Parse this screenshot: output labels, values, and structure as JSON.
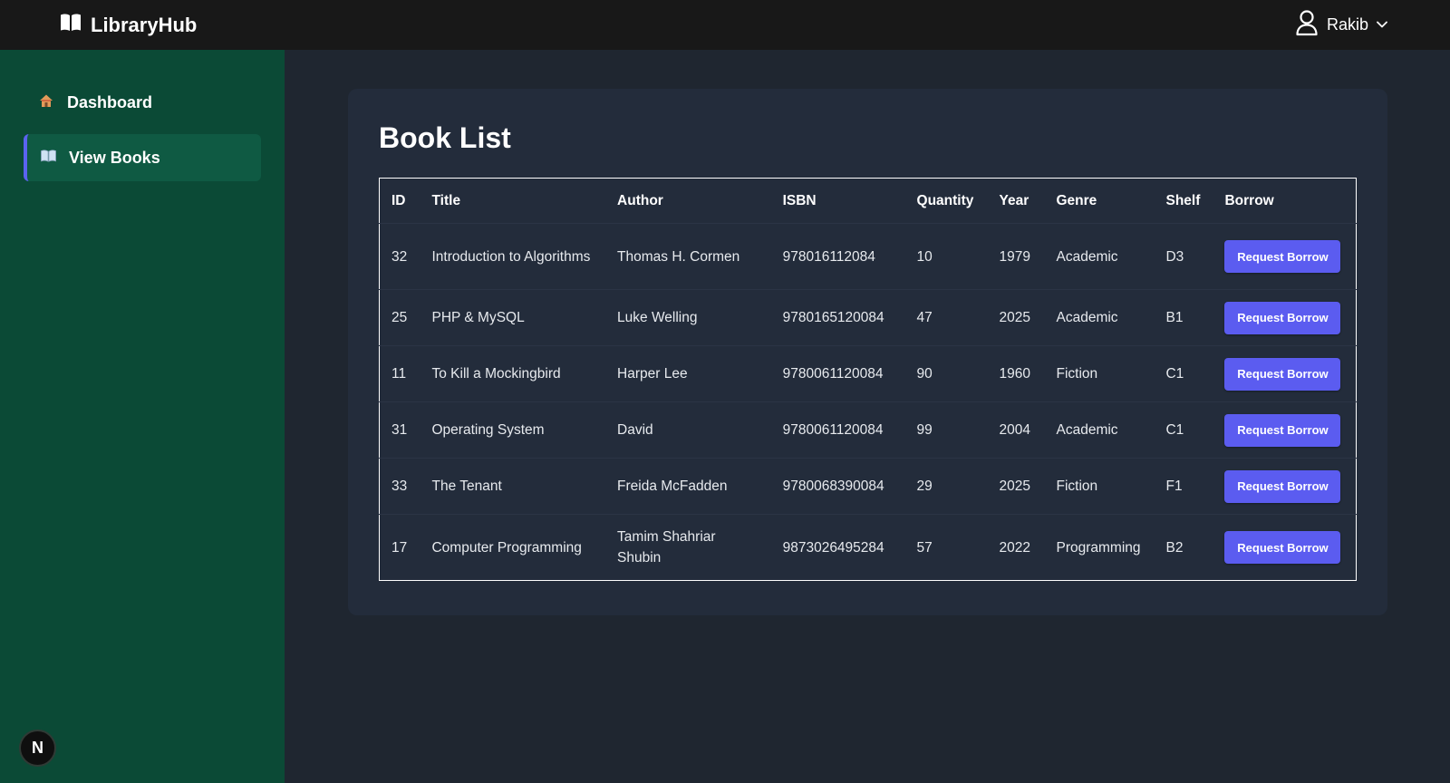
{
  "app": {
    "brand": "LibraryHub",
    "user_name": "Rakib"
  },
  "sidebar": {
    "items": [
      {
        "label": "Dashboard",
        "icon": "house-icon",
        "active": false
      },
      {
        "label": "View Books",
        "icon": "book-icon",
        "active": true
      }
    ],
    "badge": "N"
  },
  "main": {
    "title": "Book List",
    "columns": [
      "ID",
      "Title",
      "Author",
      "ISBN",
      "Quantity",
      "Year",
      "Genre",
      "Shelf",
      "Borrow"
    ],
    "borrow_button_label": "Request Borrow",
    "rows": [
      {
        "id": "32",
        "title": "Introduction to Algorithms",
        "author": "Thomas H. Cormen",
        "isbn": "978016112084",
        "quantity": "10",
        "year": "1979",
        "genre": "Academic",
        "shelf": "D3"
      },
      {
        "id": "25",
        "title": "PHP & MySQL",
        "author": "Luke Welling",
        "isbn": "9780165120084",
        "quantity": "47",
        "year": "2025",
        "genre": "Academic",
        "shelf": "B1"
      },
      {
        "id": "11",
        "title": "To Kill a Mockingbird",
        "author": "Harper Lee",
        "isbn": "9780061120084",
        "quantity": "90",
        "year": "1960",
        "genre": "Fiction",
        "shelf": "C1"
      },
      {
        "id": "31",
        "title": "Operating System",
        "author": "David",
        "isbn": "9780061120084",
        "quantity": "99",
        "year": "2004",
        "genre": "Academic",
        "shelf": "C1"
      },
      {
        "id": "33",
        "title": "The Tenant",
        "author": "Freida McFadden",
        "isbn": "9780068390084",
        "quantity": "29",
        "year": "2025",
        "genre": "Fiction",
        "shelf": "F1"
      },
      {
        "id": "17",
        "title": "Computer Programming",
        "author": "Tamim Shahriar Shubin",
        "isbn": "9873026495284",
        "quantity": "57",
        "year": "2022",
        "genre": "Programming",
        "shelf": "B2"
      }
    ]
  },
  "colors": {
    "topbar": "#181818",
    "sidebar": "#0b4a36",
    "sidebar_active": "#0f5a43",
    "accent": "#5b63f0",
    "button": "#5b5cf0",
    "card": "#232c3b",
    "background": "#1f2630"
  }
}
